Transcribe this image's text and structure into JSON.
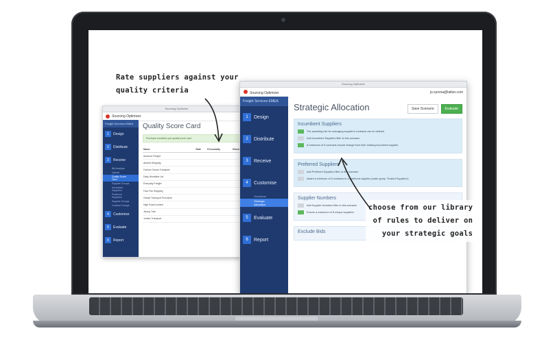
{
  "annotation_top": [
    "Rate suppliers against your",
    "quality criteria"
  ],
  "annotation_right": [
    "choose from our library",
    "of rules to deliver on",
    "your strategic goals"
  ],
  "back_window": {
    "app_name": "Sourcing Optimizer",
    "org": "Freight Services EMEA",
    "page_title": "Quality Score Card",
    "notice": "Purchase considers you quality score card",
    "steps": [
      {
        "num": "1",
        "label": "Design"
      },
      {
        "num": "2",
        "label": "Distribute"
      },
      {
        "num": "3",
        "label": "Receive"
      },
      {
        "num": "4",
        "label": "Customise"
      },
      {
        "num": "5",
        "label": "Evaluate"
      },
      {
        "num": "6",
        "label": "Report"
      }
    ],
    "receive_subitems": [
      "Bid Analysis",
      "Upload",
      "Quality Score Card",
      "Supplier Groups",
      "Incumbent Suppliers",
      "Preferred Suppliers",
      "Supplier Groups",
      "Contract Groups"
    ],
    "table_headers": [
      "Name",
      "Rate",
      "Personality",
      "Others"
    ],
    "rows": [
      "Amazon Freight",
      "Absent Shipping",
      "Carbon Ocean Transport",
      "Daily Worldline Ltd",
      "Everyday Freight",
      "Fast Fire Shipping",
      "Global Transport Providers",
      "High Road Limited",
      "Jimmy Trail",
      "Jumbo Transport"
    ]
  },
  "front_window": {
    "app_name": "Sourcing Optimizer",
    "user": "jo.syrena@latlon.com",
    "org": "Freight Services EMEA",
    "page_title": "Strategic Allocation",
    "btn_save_scenario": "Save Scenario",
    "btn_evaluate": "Evaluate",
    "steps": [
      {
        "num": "1",
        "label": "Design"
      },
      {
        "num": "2",
        "label": "Distribute"
      },
      {
        "num": "3",
        "label": "Receive"
      },
      {
        "num": "4",
        "label": "Customise"
      },
      {
        "num": "5",
        "label": "Evaluate"
      },
      {
        "num": "6",
        "label": "Report"
      }
    ],
    "customise_subitems": [
      "Scenarios",
      "Strategic Allocation"
    ],
    "panels": [
      {
        "title": "Incumbent Suppliers",
        "rules": [
          "The awarding rule for managing supplier's contracts can be defined",
          "Add Incumbent Suppliers filter to this scenario",
          "A maximum of 5 contracts should change from their existing incumbent supplier"
        ]
      },
      {
        "title": "Preferred Suppliers",
        "rules": [
          "Add Preferred Suppliers filter to this scenario",
          "Award a minimum of 5 contracts to a preferred supplier (under group 'Trusted Suppliers')"
        ]
      },
      {
        "title": "Supplier Numbers",
        "rules": [
          "Add Supplier Numbers filter to this scenario",
          "Ensure a maximum of 8 unique suppliers"
        ]
      },
      {
        "title": "Exclude Bids",
        "rules": []
      }
    ]
  }
}
